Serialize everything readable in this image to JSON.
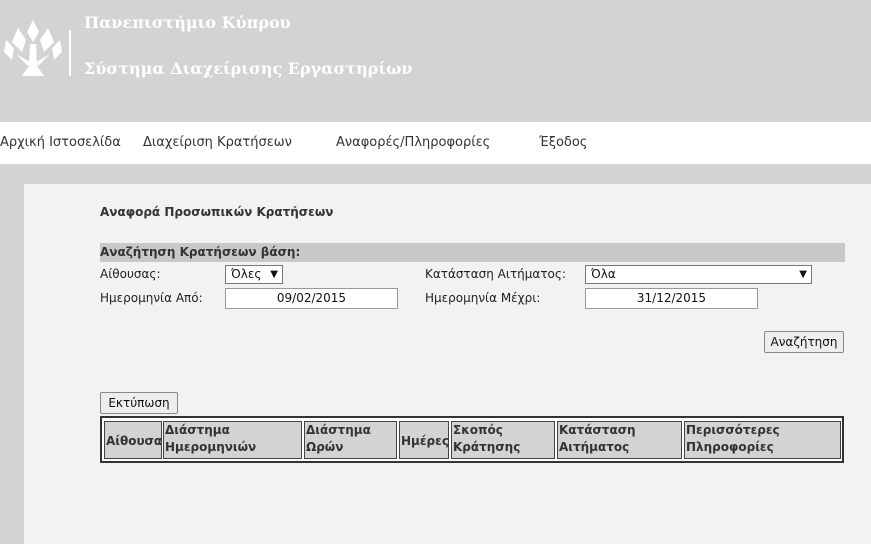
{
  "header": {
    "title": "Πανεπιστήμιο Κύπρου",
    "subtitle": "Σύστημα Διαχείρισης Εργαστηρίων",
    "logo_icon": "tree-logo-icon"
  },
  "nav": {
    "items": [
      {
        "label": "Αρχική Ιστοσελίδα"
      },
      {
        "label": "Διαχείριση Κρατήσεων"
      },
      {
        "label": "Αναφορές/Πληροφορίες"
      },
      {
        "label": "Έξοδος"
      }
    ]
  },
  "report": {
    "title": "Αναφορά Προσωπικών Κρατήσεων",
    "search_heading": "Αναζήτηση Κρατήσεων βάση:"
  },
  "filters": {
    "room_label": "Αίθουσας:",
    "room_value": "Όλες",
    "status_label": "Κατάσταση Αιτήματος:",
    "status_value": "Όλα",
    "from_label": "Ημερομηνία Από:",
    "from_value": "09/02/2015",
    "to_label": "Ημερομηνία Μέχρι:",
    "to_value": "31/12/2015"
  },
  "buttons": {
    "search": "Αναζήτηση",
    "print": "Εκτύπωση"
  },
  "table": {
    "columns": [
      {
        "label": "Αίθουσα"
      },
      {
        "label": "Διάστημα Ημερομηνιών"
      },
      {
        "label": "Διάστημα Ωρών"
      },
      {
        "label": "Ημέρες"
      },
      {
        "label": "Σκοπός Κράτησης"
      },
      {
        "label": "Κατάσταση Αιτήματος"
      },
      {
        "label": "Περισσότερες Πληροφορίες"
      }
    ]
  },
  "colors": {
    "header_bg": "#d3d3d3",
    "content_bg": "#f2f2f2",
    "table_header_bg": "#d3d3d3"
  }
}
